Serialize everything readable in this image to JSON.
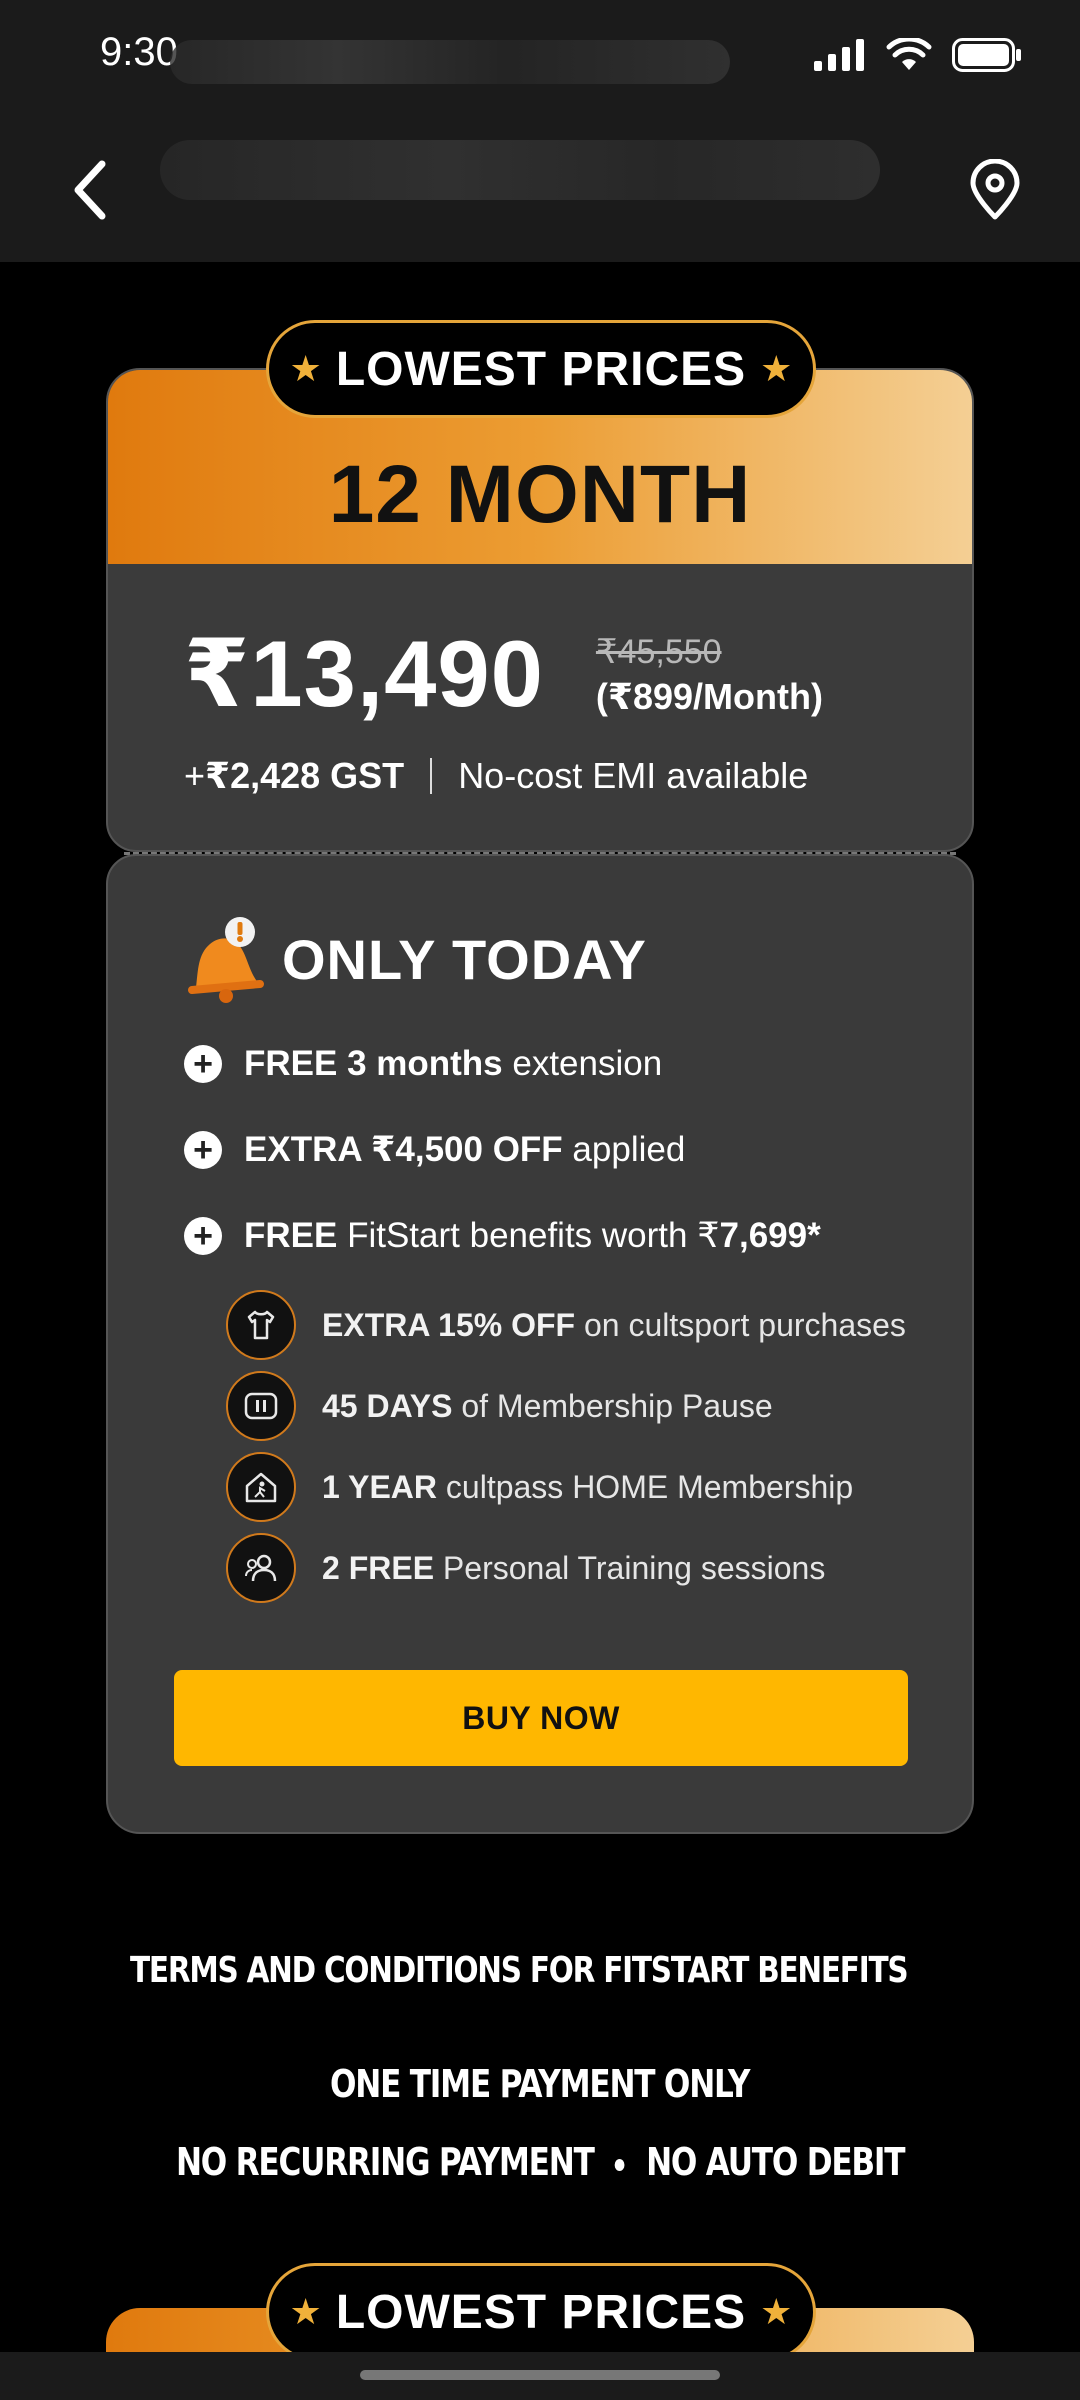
{
  "status_bar": {
    "time": "9:30"
  },
  "card": {
    "badge": "LOWEST PRICES",
    "duration": "12 MONTH",
    "price": "₹13,490",
    "original_price": "₹45,550",
    "monthly": "(₹899/Month)",
    "gst_prefix": "+ ",
    "gst_amount": "₹2,428 GST",
    "emi_text": "No-cost EMI available",
    "offer_title": "ONLY TODAY",
    "offers": [
      {
        "bold": "FREE 3 months",
        "rest": " extension"
      },
      {
        "bold": "EXTRA ₹4,500 OFF",
        "rest": " applied"
      },
      {
        "bold": "FREE",
        "rest": " FitStart benefits worth ₹",
        "bold2": "7,699*"
      }
    ],
    "benefits": [
      {
        "icon": "tshirt-icon",
        "bold": "EXTRA 15% OFF",
        "rest": " on cultsport purchases"
      },
      {
        "icon": "pause-card-icon",
        "bold": "45 DAYS",
        "rest": " of Membership Pause"
      },
      {
        "icon": "home-workout-icon",
        "bold": "1 YEAR",
        "rest": " cultpass HOME Membership"
      },
      {
        "icon": "trainer-icon",
        "bold": "2 FREE",
        "rest": " Personal Training sessions"
      }
    ],
    "buy_label": "BUY NOW"
  },
  "terms": {
    "label": "TERMS AND CONDITIONS FOR FITSTART BENEFITS"
  },
  "payment": {
    "line1": "ONE TIME PAYMENT ONLY",
    "line2a": "NO RECURRING PAYMENT",
    "line2b": "NO AUTO DEBIT"
  },
  "next_card": {
    "badge": "LOWEST PRICES"
  },
  "colors": {
    "accent": "#ffb700",
    "orange": "#e07a0e",
    "card_bg": "#3a3a3a"
  }
}
